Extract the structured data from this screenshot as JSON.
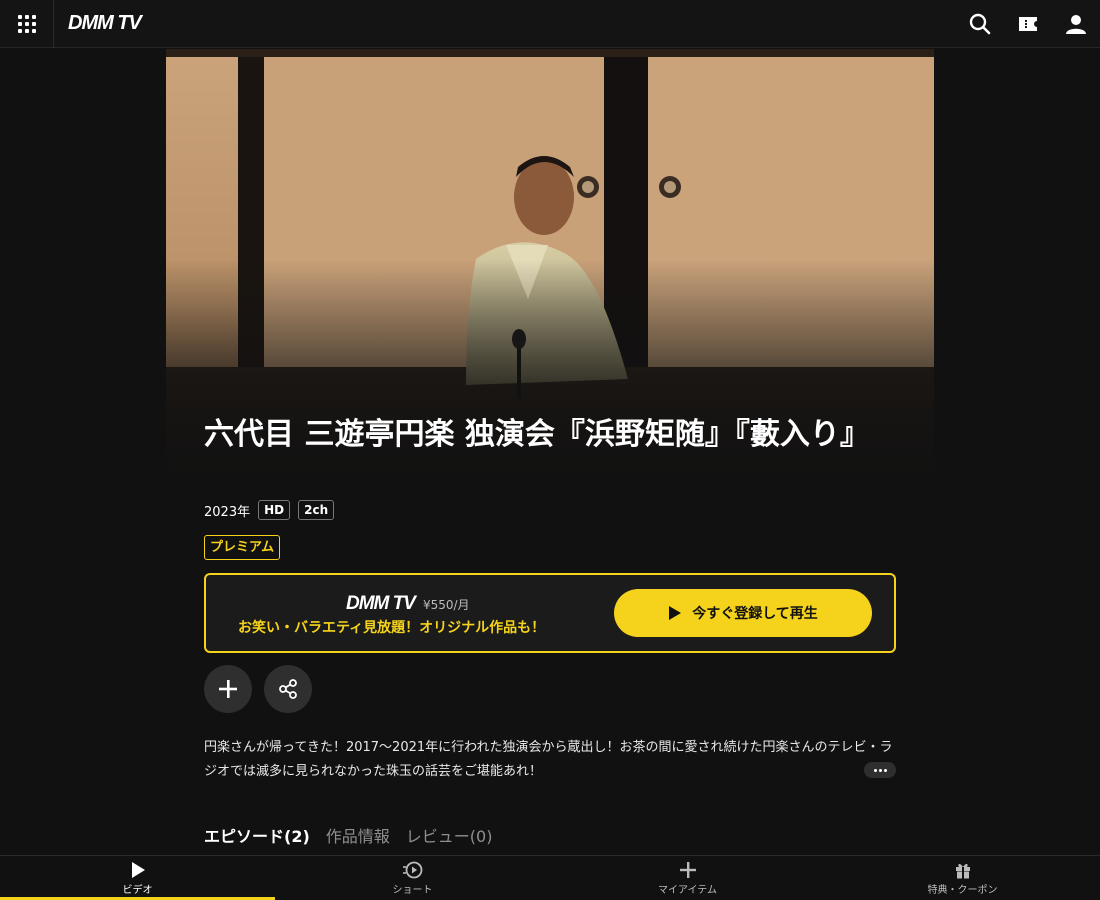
{
  "header": {
    "logo": "DMM TV",
    "icons": [
      "grid-menu-icon",
      "search-icon",
      "ticket-icon",
      "user-icon"
    ]
  },
  "video": {
    "title": "六代目 三遊亭円楽 独演会『浜野矩随』『藪入り』",
    "year": "2023年",
    "badges": [
      "HD",
      "2ch"
    ],
    "premium_label": "プレミアム"
  },
  "subscription": {
    "logo": "DMM TV",
    "price": "¥550/月",
    "tagline": "お笑い・バラエティ見放題！オリジナル作品も！",
    "button_label": "今すぐ登録して再生"
  },
  "description": "円楽さんが帰ってきた！2017〜2021年に行われた独演会から蔵出し！お茶の間に愛され続けた円楽さんのテレビ・ラジオでは滅多に見られなかった珠玉の話芸をご堪能あれ！",
  "tabs": [
    "エピソード(2)",
    "作品情報",
    "レビュー(0)"
  ],
  "bottom_nav": [
    "ビデオ",
    "ショート",
    "マイアイテム",
    "特典・クーポン"
  ],
  "colors": {
    "accent": "#f5d31c",
    "background": "#111111",
    "round_button": "#2f2f2f"
  }
}
